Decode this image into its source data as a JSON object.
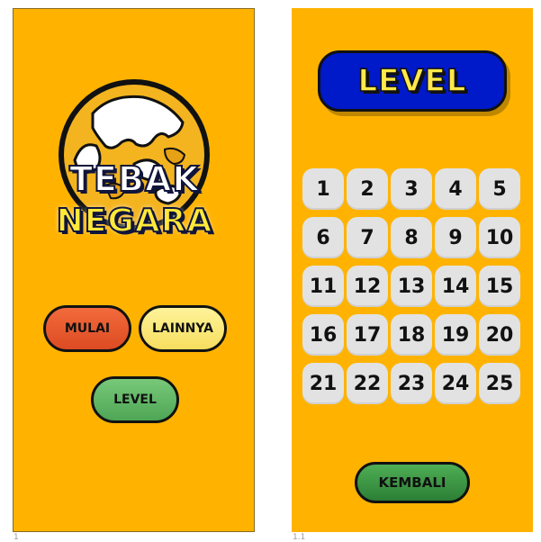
{
  "main_screen": {
    "logo_line1": "TEBAK",
    "logo_line2": "NEGARA",
    "buttons": {
      "mulai": "MULAI",
      "lainnya": "LAINNYA",
      "level": "LEVEL"
    },
    "page_number": "1"
  },
  "level_screen": {
    "title": "LEVEL",
    "levels": [
      "1",
      "2",
      "3",
      "4",
      "5",
      "6",
      "7",
      "8",
      "9",
      "10",
      "11",
      "12",
      "13",
      "14",
      "15",
      "16",
      "17",
      "18",
      "19",
      "20",
      "21",
      "22",
      "23",
      "24",
      "25"
    ],
    "back_button": "KEMBALI",
    "page_number": "1.1"
  },
  "colors": {
    "background": "#ffb300",
    "mulai": "#e85a2d",
    "lainnya": "#fbe36f",
    "level_button": "#5fb365",
    "level_banner": "#0019c9",
    "kembali": "#2f8a38",
    "level_cell": "#e2e2e2"
  },
  "icons": {
    "logo": "globe-icon"
  }
}
